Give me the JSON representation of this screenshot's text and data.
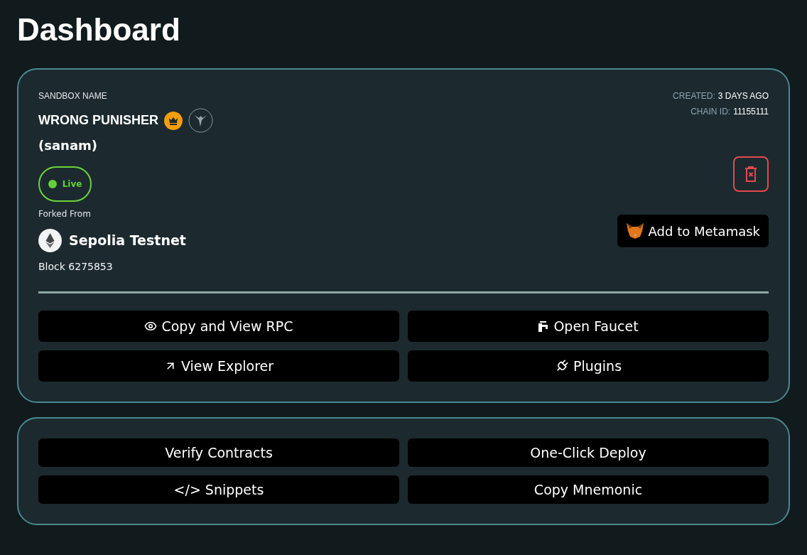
{
  "page_title": "Dashboard",
  "sandbox": {
    "name_label": "SANDBOX NAME",
    "name": "WRONG PUNISHER",
    "owner": "(sanam)",
    "created_label": "CREATED:",
    "created_value": "3 DAYS AGO",
    "chain_label": "CHAIN ID:",
    "chain_value": "11155111",
    "status": {
      "label": "Live",
      "live": true
    },
    "forked_label": "Forked From",
    "network": "Sepolia Testnet",
    "block": "Block 6275853",
    "metamask_button": "Add to Metamask"
  },
  "actions": [
    {
      "label": "Copy and View RPC",
      "kind": "eye"
    },
    {
      "label": "Open Faucet",
      "kind": "faucet"
    },
    {
      "label": "View Explorer",
      "kind": "arrow"
    },
    {
      "label": "Plugins",
      "kind": "plug"
    }
  ],
  "tools": [
    {
      "label": "Verify Contracts"
    },
    {
      "label": "One-Click Deploy"
    },
    {
      "label": "</> Snippets"
    },
    {
      "label": "Copy Mnemonic"
    }
  ]
}
